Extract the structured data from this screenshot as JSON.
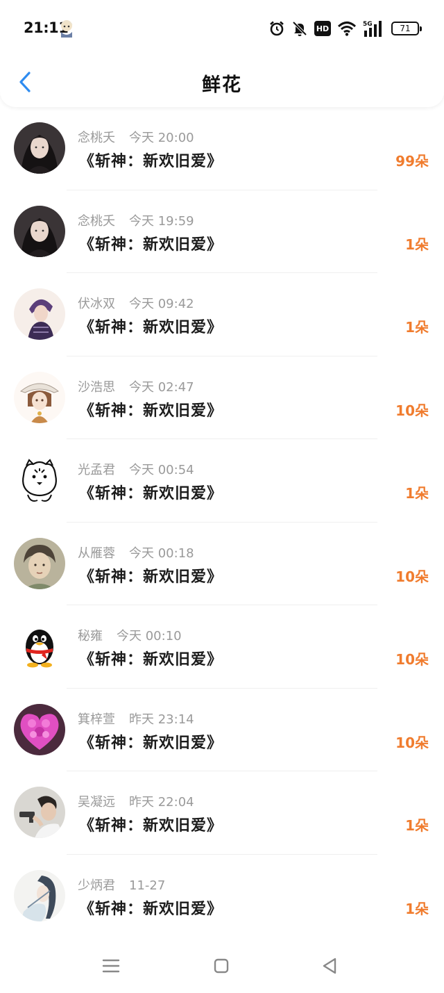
{
  "status_bar": {
    "time": "21:11",
    "battery": "71",
    "network": "5G",
    "hd": "HD"
  },
  "header": {
    "title": "鲜花"
  },
  "items": [
    {
      "name": "念桃夭",
      "time": "今天 20:00",
      "title": "《斩神：新欢旧爱》",
      "count": "99朵",
      "avatar": "girl-dark-hair"
    },
    {
      "name": "念桃夭",
      "time": "今天 19:59",
      "title": "《斩神：新欢旧爱》",
      "count": "1朵",
      "avatar": "girl-dark-hair"
    },
    {
      "name": "伏冰双",
      "time": "今天 09:42",
      "title": "《斩神：新欢旧爱》",
      "count": "1朵",
      "avatar": "boy-purple-hair"
    },
    {
      "name": "沙浩思",
      "time": "今天 02:47",
      "title": "《斩神：新欢旧爱》",
      "count": "10朵",
      "avatar": "anime-hat-boy"
    },
    {
      "name": "光孟君",
      "time": "今天 00:54",
      "title": "《斩神：新欢旧爱》",
      "count": "1朵",
      "avatar": "tiger-sketch"
    },
    {
      "name": "从雁蓉",
      "time": "今天 00:18",
      "title": "《斩神：新欢旧爱》",
      "count": "10朵",
      "avatar": "painted-boy"
    },
    {
      "name": "秘雍",
      "time": "今天 00:10",
      "title": "《斩神：新欢旧爱》",
      "count": "10朵",
      "avatar": "qq-penguin"
    },
    {
      "name": "箕梓萱",
      "time": "昨天 23:14",
      "title": "《斩神：新欢旧爱》",
      "count": "10朵",
      "avatar": "pink-flower-heart"
    },
    {
      "name": "吴凝远",
      "time": "昨天 22:04",
      "title": "《斩神：新欢旧爱》",
      "count": "1朵",
      "avatar": "man-with-gun"
    },
    {
      "name": "少炳君",
      "time": "11-27",
      "title": "《斩神：新欢旧爱》",
      "count": "1朵",
      "avatar": "ancient-swordsman"
    }
  ],
  "nav": {
    "menu_icon": "menu-icon",
    "home_icon": "home-icon",
    "back_icon": "back-triangle-icon"
  },
  "colors": {
    "accent_blue": "#2f8cf0",
    "count_orange": "#f07c2e",
    "meta_gray": "#9a9a9a"
  }
}
